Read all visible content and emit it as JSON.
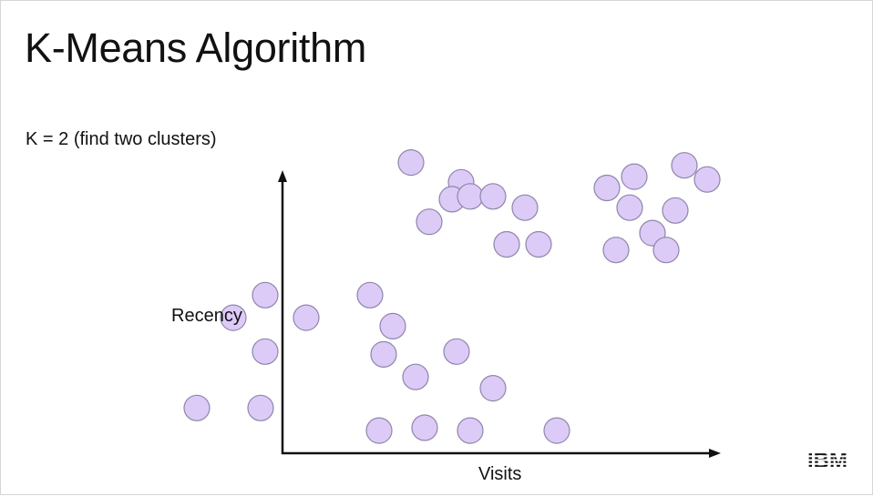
{
  "slide": {
    "title": "K-Means Algorithm",
    "subtitle": "K = 2 (find two clusters)",
    "logo_text": "IBM"
  },
  "colors": {
    "point_fill": "#dccaf7",
    "point_stroke": "#8f86aa",
    "axis": "#111111",
    "text": "#111111"
  },
  "chart_data": {
    "type": "scatter",
    "xlabel": "Visits",
    "ylabel": "Recency",
    "grid": false,
    "series": [
      {
        "points": [
          [
            1.5,
            10.4
          ],
          [
            2.6,
            9.7
          ],
          [
            2.4,
            9.1
          ],
          [
            2.8,
            9.2
          ],
          [
            3.3,
            9.2
          ],
          [
            4.0,
            8.8
          ],
          [
            5.8,
            9.5
          ],
          [
            6.4,
            9.9
          ],
          [
            7.5,
            10.3
          ],
          [
            8.0,
            9.8
          ],
          [
            6.3,
            8.8
          ],
          [
            7.3,
            8.7
          ],
          [
            6.8,
            7.9
          ],
          [
            1.9,
            8.3
          ],
          [
            3.6,
            7.5
          ],
          [
            4.3,
            7.5
          ],
          [
            6.0,
            7.3
          ],
          [
            7.1,
            7.3
          ]
        ]
      },
      {
        "points": [
          [
            -1.7,
            5.7
          ],
          [
            0.6,
            5.7
          ],
          [
            -2.4,
            4.9
          ],
          [
            -0.8,
            4.9
          ],
          [
            1.1,
            4.6
          ],
          [
            -1.7,
            3.7
          ],
          [
            0.9,
            3.6
          ],
          [
            1.6,
            2.8
          ],
          [
            2.5,
            3.7
          ],
          [
            3.3,
            2.4
          ],
          [
            -3.2,
            1.7
          ],
          [
            -1.8,
            1.7
          ],
          [
            0.8,
            0.9
          ],
          [
            1.8,
            1.0
          ],
          [
            2.8,
            0.9
          ],
          [
            4.7,
            0.9
          ]
        ]
      }
    ]
  }
}
